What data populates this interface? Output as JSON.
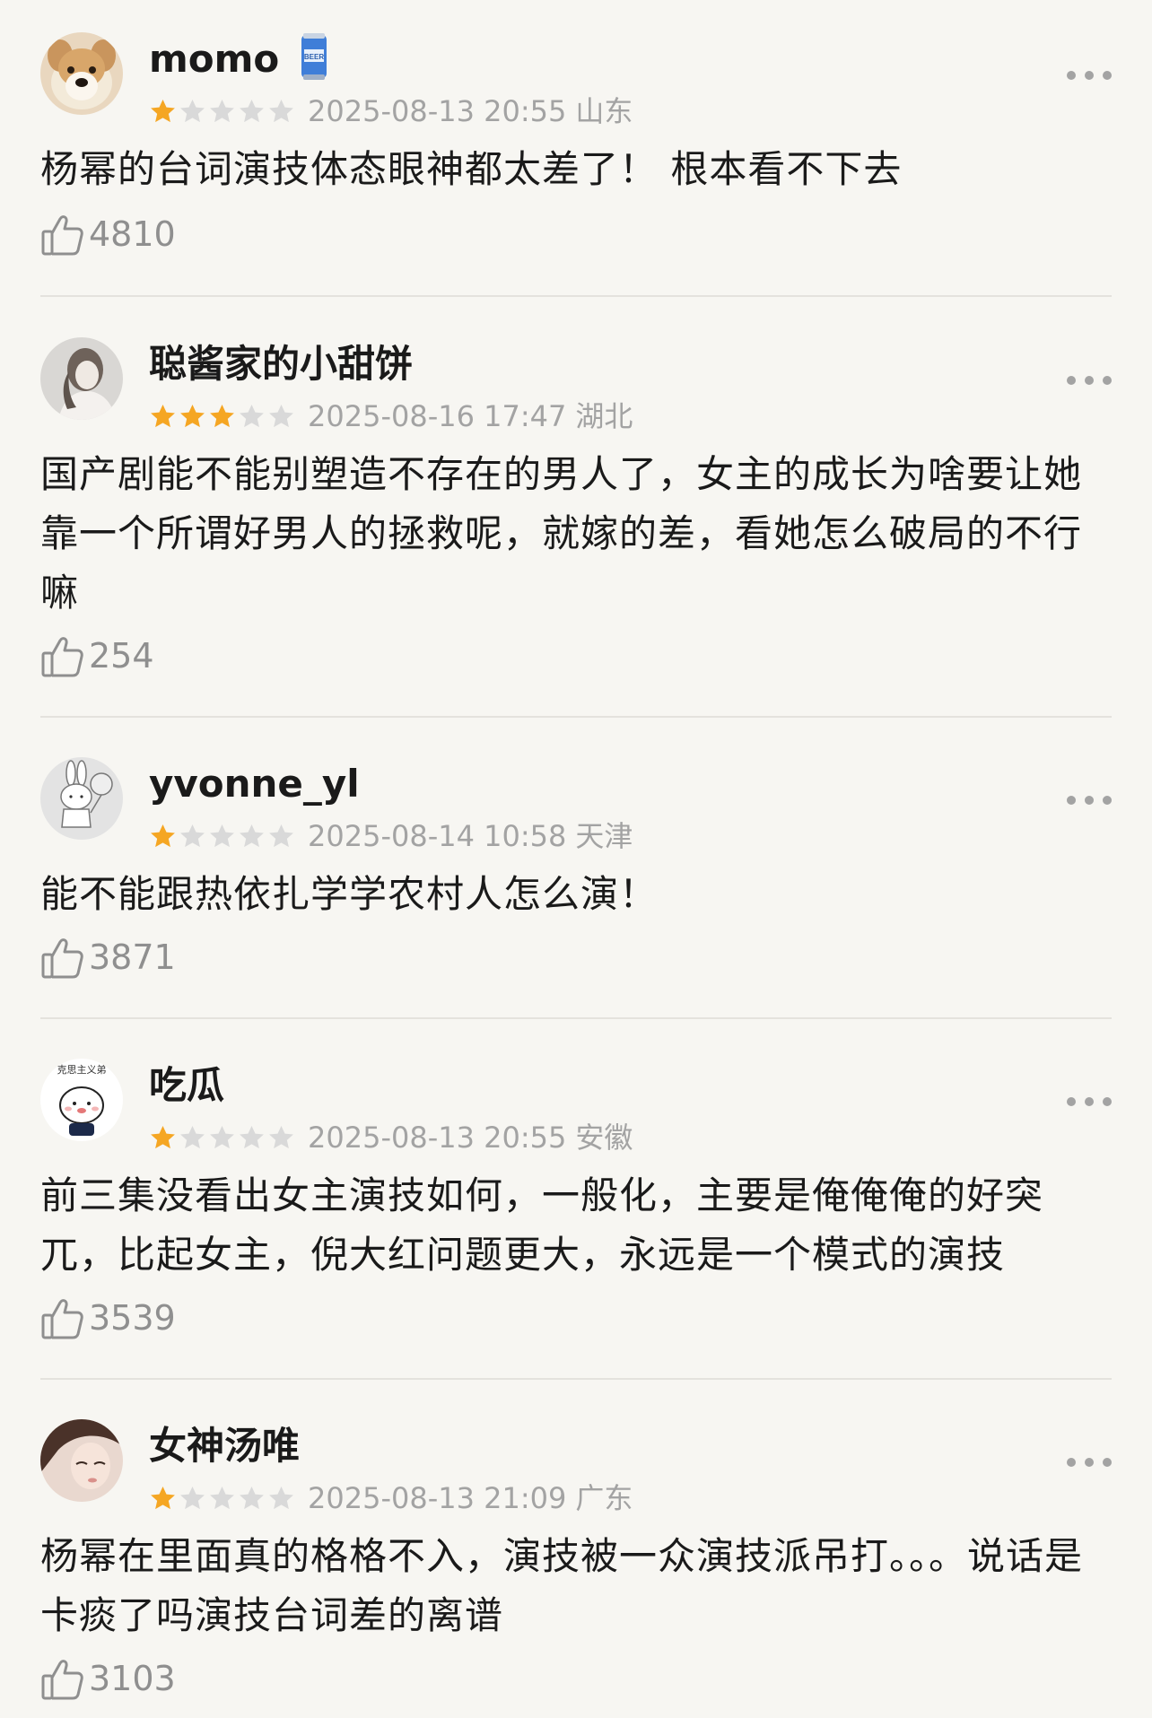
{
  "reviews": [
    {
      "username": "momo",
      "rating": 1,
      "datetime": "2025-08-13 20:55",
      "region": "山东",
      "content": "杨幂的台词演技体态眼神都太差了！ 根本看不下去",
      "likes": "4810",
      "badge": "beer-can-icon"
    },
    {
      "username": "聪酱家的小甜饼",
      "rating": 3,
      "datetime": "2025-08-16 17:47",
      "region": "湖北",
      "content": "国产剧能不能别塑造不存在的男人了，女主的成长为啥要让她靠一个所谓好男人的拯救呢，就嫁的差，看她怎么破局的不行嘛",
      "likes": "254"
    },
    {
      "username": "yvonne_yl",
      "rating": 1,
      "datetime": "2025-08-14 10:58",
      "region": "天津",
      "content": "能不能跟热依扎学学农村人怎么演！",
      "likes": "3871"
    },
    {
      "username": "吃瓜",
      "rating": 1,
      "datetime": "2025-08-13 20:55",
      "region": "安徽",
      "content": "前三集没看出女主演技如何，一般化，主要是俺俺俺的好突兀，比起女主，倪大红问题更大，永远是一个模式的演技",
      "likes": "3539",
      "avatar_text": "克思主义弟"
    },
    {
      "username": "女神汤唯",
      "rating": 1,
      "datetime": "2025-08-13 21:09",
      "region": "广东",
      "content": "杨幂在里面真的格格不入，演技被一众演技派吊打。。。说话是卡痰了吗演技台词差的离谱",
      "likes": "3103"
    }
  ],
  "colors": {
    "background": "#f7f6f2",
    "star_filled": "#f5a623",
    "star_empty": "#d9d9d9",
    "meta_text": "#a3a3a3",
    "divider": "#e4e2dd"
  },
  "icons": {
    "more": "more-dots-icon",
    "like": "thumbs-up-icon",
    "star": "star-icon"
  }
}
